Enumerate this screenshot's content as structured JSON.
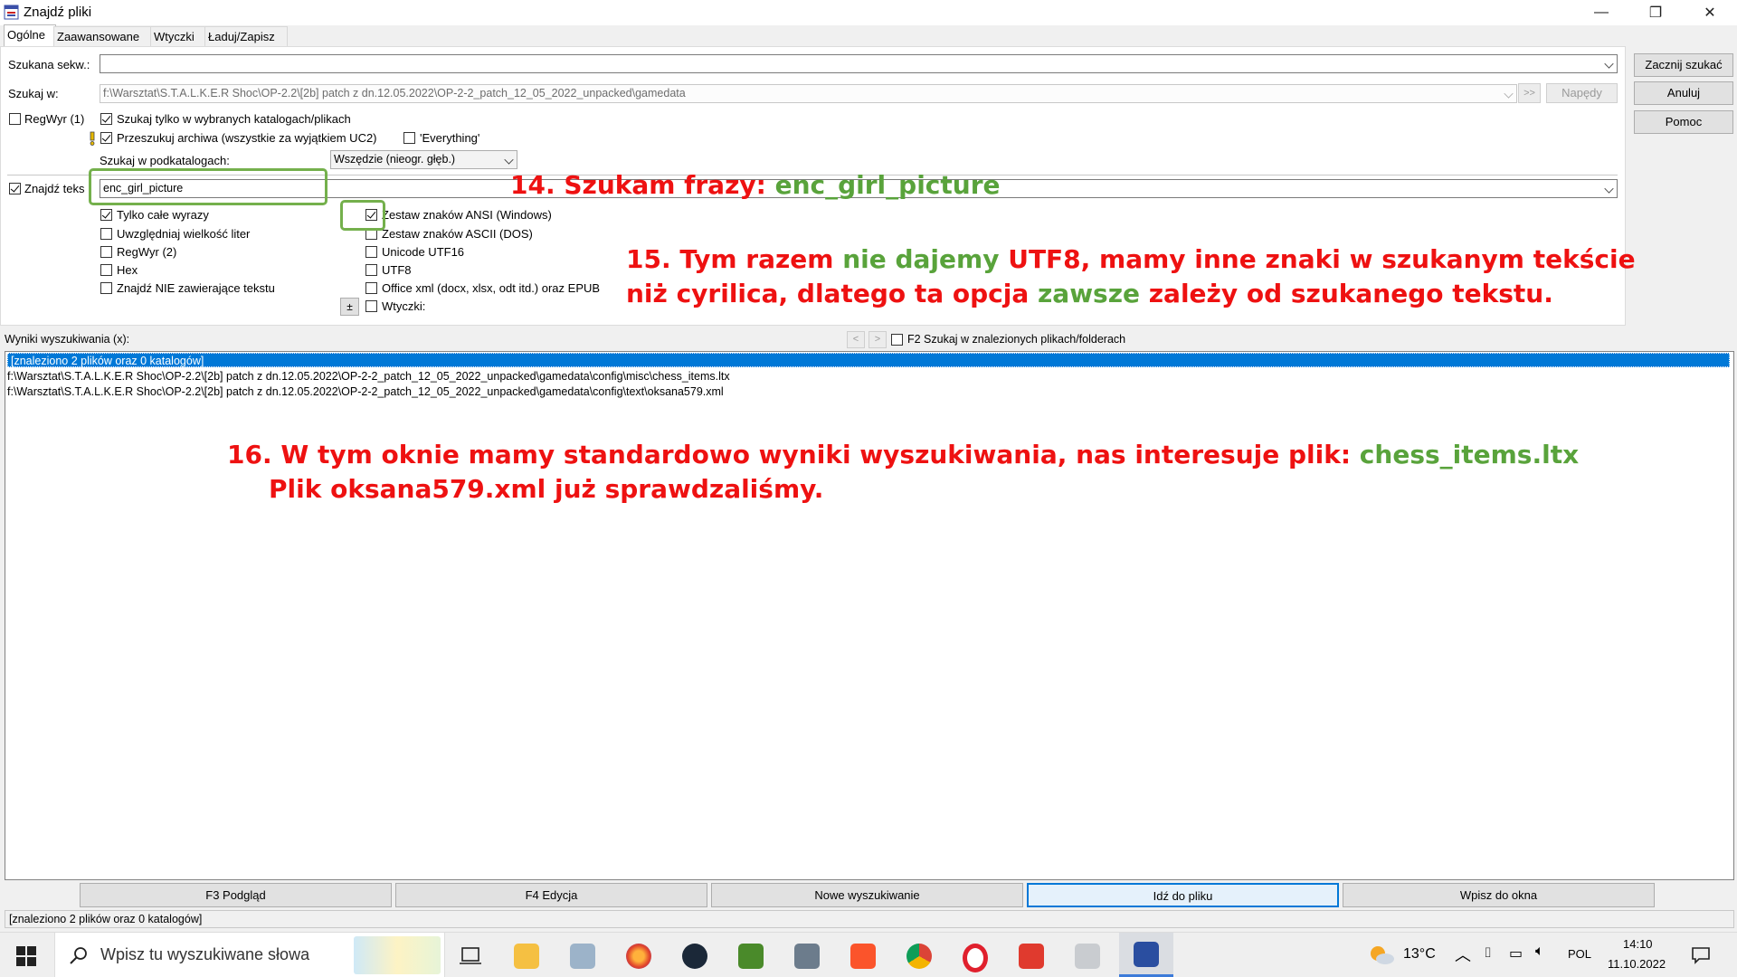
{
  "window": {
    "title": "Znajdź pliki",
    "minimize": "—",
    "maximize": "❐",
    "close": "✕"
  },
  "tabs": [
    "Ogólne",
    "Zaawansowane",
    "Wtyczki",
    "Ładuj/Zapisz"
  ],
  "form": {
    "search_for_label": "Szukana sekw.:",
    "search_for_value": "",
    "search_in_label": "Szukaj w:",
    "search_in_value": "f:\\Warsztat\\S.T.A.L.K.E.R Shoc\\OP-2.2\\[2b] patch z dn.12.05.2022\\OP-2-2_patch_12_05_2022_unpacked\\gamedata",
    "more_btn": ">>",
    "drives_btn": "Napędy",
    "regex1_label": "RegWyr (1)",
    "only_selected_label": "Szukaj tylko w wybranych katalogach/plikach",
    "archives_label": "Przeszukuj archiwa (wszystkie za wyjątkiem UC2)",
    "everything_label": "'Everything'",
    "subdirs_label": "Szukaj w podkatalogach:",
    "subdirs_value": "Wszędzie (nieogr. głęb.)",
    "find_text_label": "Znajdź teks",
    "find_text_value": "enc_girl_picture",
    "options_left": [
      "Tylko całe wyrazy",
      "Uwzględniaj wielkość liter",
      "RegWyr (2)",
      "Hex",
      "Znajdź NIE zawierające tekstu"
    ],
    "options_right": [
      "Zestaw znaków ANSI (Windows)",
      "Zestaw znaków ASCII (DOS)",
      "Unicode UTF16",
      "UTF8",
      "Office xml (docx, xlsx, odt itd.) oraz EPUB",
      "Wtyczki:"
    ],
    "plus_btn": "±"
  },
  "side_buttons": {
    "start": "Zacznij szukać",
    "cancel": "Anuluj",
    "help": "Pomoc"
  },
  "results": {
    "label": "Wyniki wyszukiwania (x):",
    "nav_prev": "<",
    "nav_next": ">",
    "f2_label": "F2 Szukaj w znalezionych plikach/folderach",
    "rows": [
      "[znaleziono 2 plików oraz 0 katalogów]",
      "f:\\Warsztat\\S.T.A.L.K.E.R Shoc\\OP-2.2\\[2b] patch z dn.12.05.2022\\OP-2-2_patch_12_05_2022_unpacked\\gamedata\\config\\misc\\chess_items.ltx",
      "f:\\Warsztat\\S.T.A.L.K.E.R Shoc\\OP-2.2\\[2b] patch z dn.12.05.2022\\OP-2-2_patch_12_05_2022_unpacked\\gamedata\\config\\text\\oksana579.xml"
    ]
  },
  "bottom_buttons": [
    "F3 Podgląd",
    "F4 Edycja",
    "Nowe wyszukiwanie",
    "Idź do pliku",
    "Wpisz do okna"
  ],
  "status_text": "[znaleziono 2 plików oraz 0 katalogów]",
  "annotations": {
    "a14_prefix": "14.  Szukam frazy: ",
    "a14_green": "enc_girl_picture",
    "a15_l1_p1": "15. Tym razem ",
    "a15_l1_g1": "nie dajemy",
    "a15_l1_p2": " UTF8, mamy inne znaki w szukanym tekście",
    "a15_l2_p1": "niż cyrilica, dlatego ta opcja ",
    "a15_l2_g1": "zawsze",
    "a15_l2_p2": " zależy od szukanego tekstu.",
    "a16_l1": "16. W tym oknie mamy standardowo wyniki wyszukiwania, nas interesuje plik:  ",
    "a16_green": "chess_items.ltx",
    "a16_l2": "Plik oksana579.xml już sprawdzaliśmy."
  },
  "taskbar": {
    "search_placeholder": "Wpisz tu wyszukiwane słowa",
    "temperature": "13°C",
    "language": "POL",
    "time": "14:10",
    "date": "11.10.2022"
  },
  "colors": {
    "selection": "#0078d7",
    "annotation_red": "#e11111",
    "annotation_green": "#59a33b"
  }
}
